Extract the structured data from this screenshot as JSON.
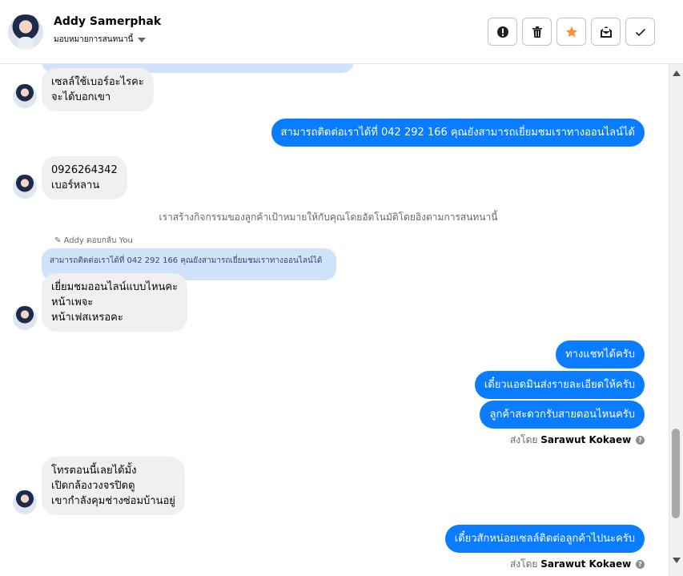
{
  "header": {
    "name": "Addy Samerphak",
    "subtitle": "มอบหมายการสนทนานี้",
    "toolbar": [
      {
        "icon": "alert-icon",
        "label": "spam"
      },
      {
        "icon": "trash-icon",
        "label": "delete"
      },
      {
        "icon": "star-icon",
        "label": "star"
      },
      {
        "icon": "mark-unread-icon",
        "label": "mark unread"
      },
      {
        "icon": "check-icon",
        "label": "done"
      }
    ],
    "star_color": "#f7923a"
  },
  "messages": {
    "m1": {
      "line1": "เซลล์ใช้เบอร์อะไรคะ",
      "line2": "จะได้บอกเขา"
    },
    "m2": "สามารถติดต่อเราได้ที่ 042 292 166 คุณยังสามารถเยี่ยมชมเราทางออนไลน์ได้",
    "m3": {
      "line1": "0926264342",
      "line2": "เบอร์หลาน"
    },
    "system": "เราสร้างกิจกรรมของลูกค้าเป้าหมายให้กับคุณโดยอัตโนมัติโดยอิงตามการสนทนานี้",
    "reply_label": "Addy ตอบกลับ You",
    "reply_quote": "สามารถติดต่อเราได้ที่ 042 292 166 คุณยังสามารถเยี่ยมชมเราทางออนไลน์ได้",
    "m4": {
      "line1": "เยี่ยมชมออนไลน์แบบไหนคะ",
      "line2": "หน้าเพจะ",
      "line3": "หน้าเฟสเหรอคะ"
    },
    "m5": "ทางแชทได้ครับ",
    "m6": "เดี๋ยวแอดมินส่งรายละเอียดให้ครับ",
    "m7": "ลูกค้าสะดวกรับสายตอนไหนครับ",
    "sent_by_prefix": "ส่งโดย",
    "sent_by_name": "Sarawut Kokaew",
    "m8": {
      "line1": "โทรตอนนี้เลยได้มั้ง",
      "line2": "เปิดกล้องวงจรปิดดู",
      "line3": "เขากำลังคุมช่างซ่อมบ้านอยู่"
    },
    "m9": "เดี๋ยวสักหน่อยเซลล์ติดต่อลูกค้าไปนะครับ",
    "sent_by_prefix_2": "ส่งโดย",
    "sent_by_name_2": "Sarawut Kokaew"
  },
  "colors": {
    "outgoing": "#0a7cff",
    "incoming": "#f0f0f0",
    "reply_quote": "#cfe3fb"
  }
}
